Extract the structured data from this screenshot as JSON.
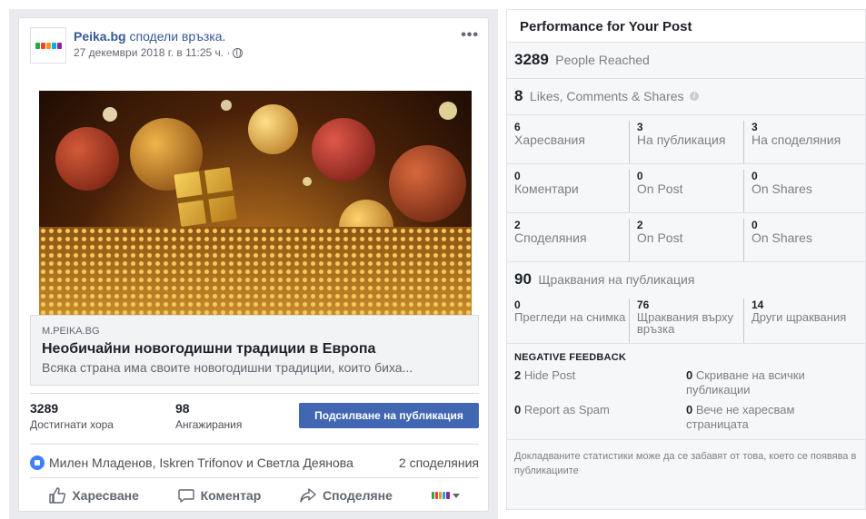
{
  "post": {
    "page_name": "Peika.bg",
    "action_text": "сподели връзка.",
    "timestamp": "27 декември 2018 г. в 11:25 ч. ·",
    "more_label": "•••",
    "link": {
      "domain": "M.PEIKA.BG",
      "title": "Необичайни новогодишни традиции в Европа",
      "description": "Всяка страна има своите новогодишни традиции, които биха..."
    },
    "stats": {
      "reach_value": "3289",
      "reach_label": "Достигнати хора",
      "engagement_value": "98",
      "engagement_label": "Ангажирания"
    },
    "boost_label": "Подсилване на публикация",
    "reactions_names": "Милен Младенов, Iskren Trifonov и Светла Деянова",
    "shares_count": "2 споделяния",
    "actions": {
      "like": "Харесване",
      "comment": "Коментар",
      "share": "Споделяне"
    },
    "brand_colors": [
      "#2ba84a",
      "#ef4136",
      "#f7941d",
      "#00aeef",
      "#92278f"
    ]
  },
  "performance": {
    "title": "Performance for Your Post",
    "reached": {
      "value": "3289",
      "label": "People Reached"
    },
    "engagement": {
      "value": "8",
      "label": "Likes, Comments & Shares"
    },
    "rows": [
      {
        "cells": [
          {
            "num": "6",
            "label": "Харесвания"
          },
          {
            "num": "3",
            "label": "На публикация"
          },
          {
            "num": "3",
            "label": "На споделяния"
          }
        ]
      },
      {
        "cells": [
          {
            "num": "0",
            "label": "Коментари"
          },
          {
            "num": "0",
            "label": "On Post"
          },
          {
            "num": "0",
            "label": "On Shares"
          }
        ]
      },
      {
        "cells": [
          {
            "num": "2",
            "label": "Споделяния"
          },
          {
            "num": "2",
            "label": "On Post"
          },
          {
            "num": "0",
            "label": "On Shares"
          }
        ]
      }
    ],
    "clicks": {
      "value": "90",
      "label": "Щраквания на публикация"
    },
    "click_breakdown": [
      {
        "num": "0",
        "label": "Прегледи на снимка"
      },
      {
        "num": "76",
        "label": "Щраквания върху връзка"
      },
      {
        "num": "14",
        "label": "Други щраквания"
      }
    ],
    "negative": {
      "title": "NEGATIVE FEEDBACK",
      "items": [
        {
          "num": "2",
          "label": "Hide Post"
        },
        {
          "num": "0",
          "label": "Скриване на всички публикации"
        },
        {
          "num": "0",
          "label": "Report as Spam"
        },
        {
          "num": "0",
          "label": "Вече не харесвам страницата"
        }
      ]
    },
    "footnote": "Докладваните статистики може да се забавят от това, което се появява в публикациите"
  }
}
